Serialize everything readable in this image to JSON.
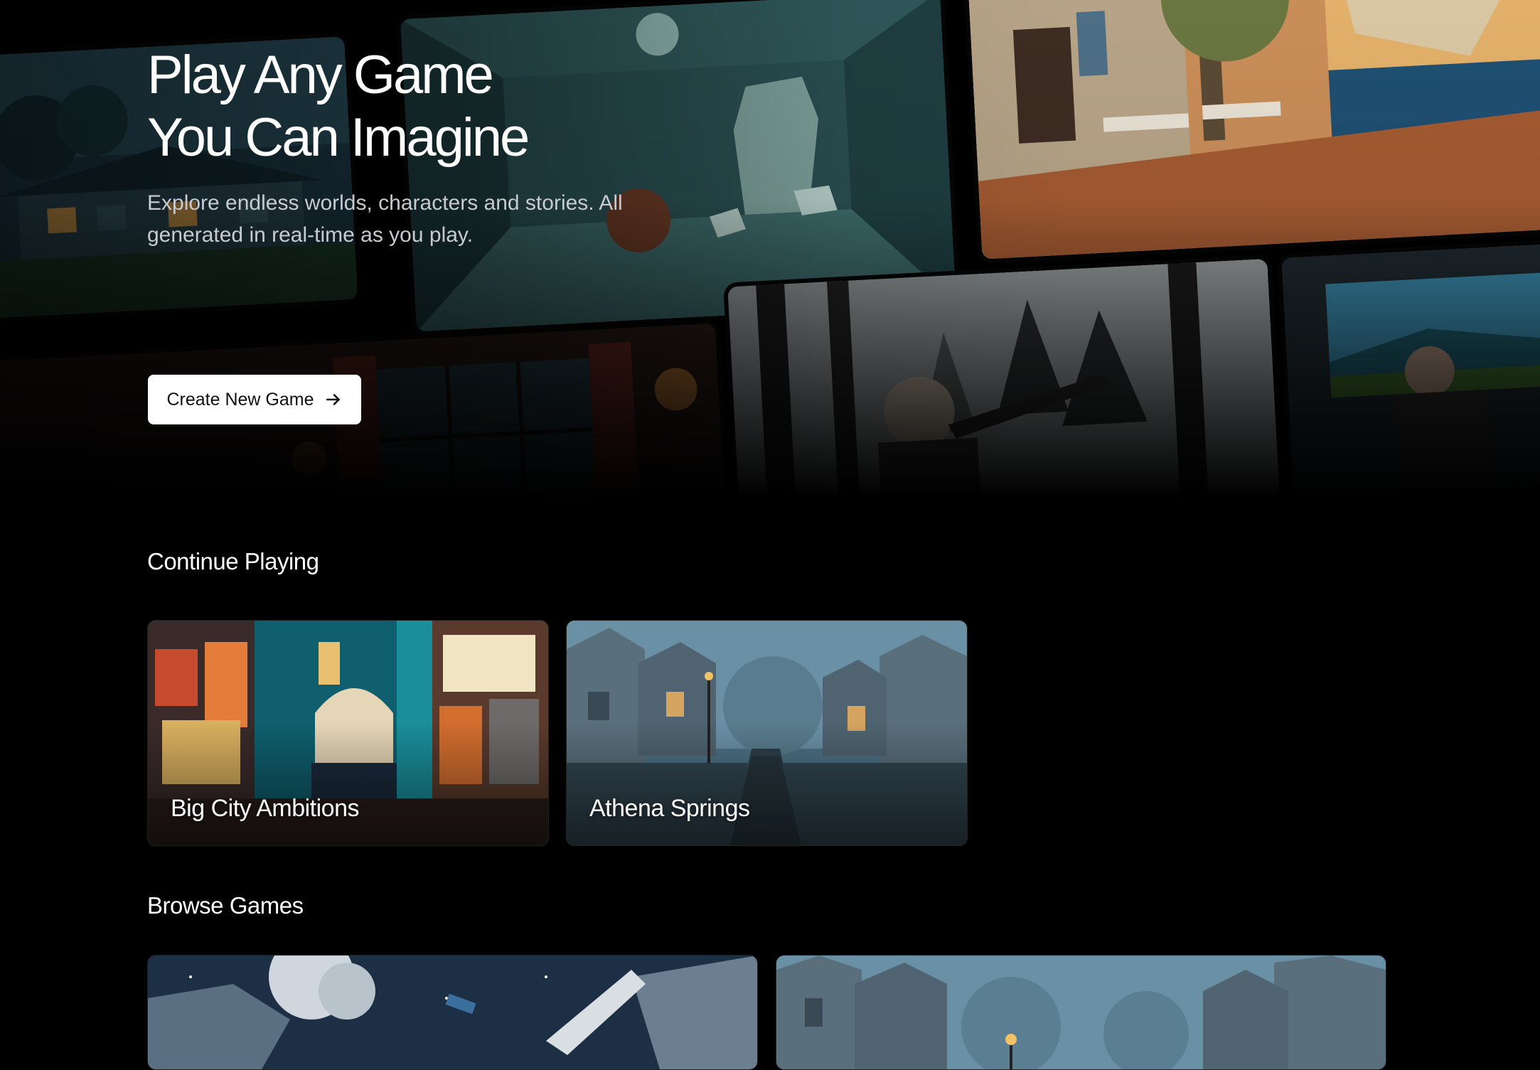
{
  "hero": {
    "title_line1": "Play Any Game",
    "title_line2": "You Can Imagine",
    "subtitle": "Explore endless worlds, characters and stories. All generated in real-time as you play.",
    "cta_label": "Create New Game",
    "cta_icon": "arrow-right-icon"
  },
  "continue_playing": {
    "title": "Continue Playing",
    "games": [
      {
        "title": "Big City Ambitions"
      },
      {
        "title": "Athena Springs"
      }
    ]
  },
  "browse_games": {
    "title": "Browse Games"
  },
  "colors": {
    "background": "#000000",
    "cta_background": "#ffffff",
    "cta_text": "#111111",
    "subtitle_text": "#c7cbd1"
  }
}
